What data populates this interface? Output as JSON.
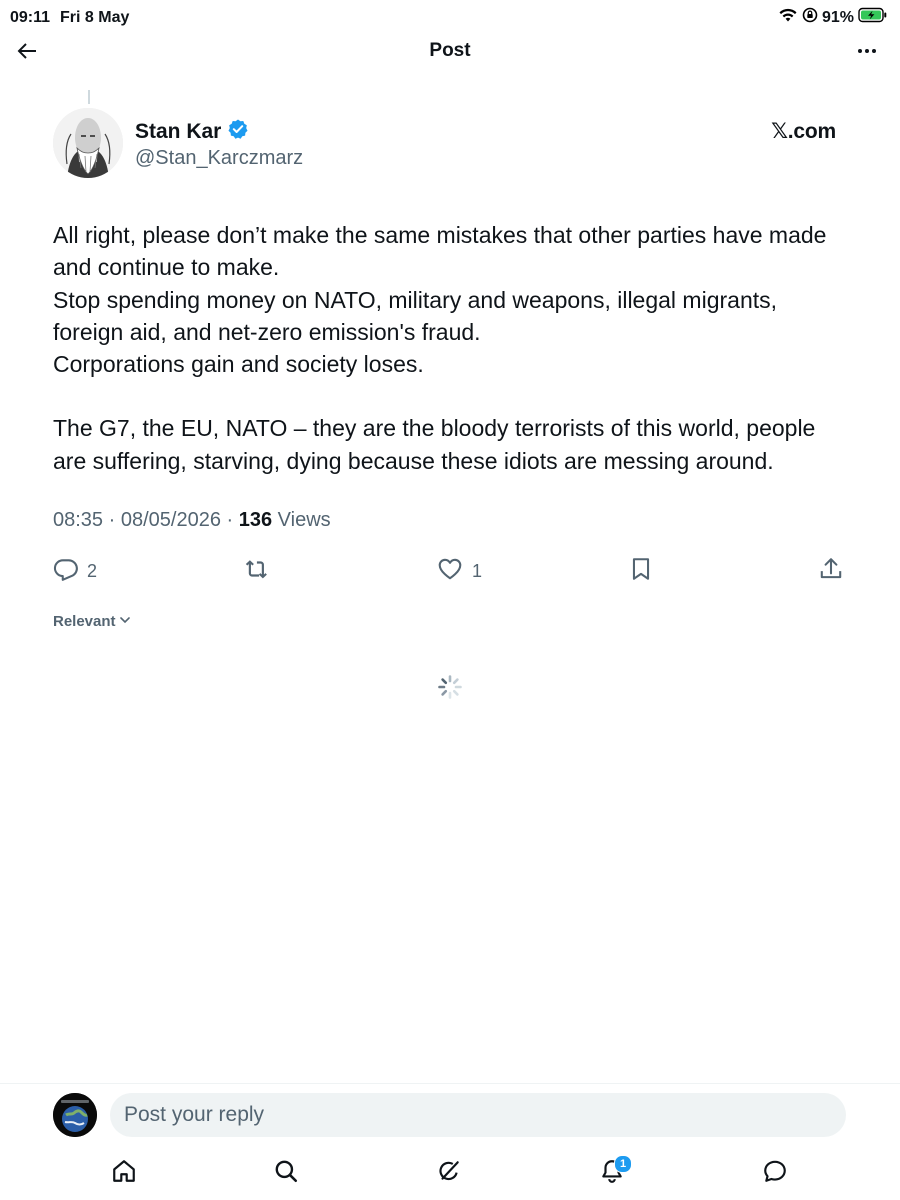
{
  "status_bar": {
    "time": "09:11",
    "date": "Fri 8 May",
    "battery": "91%",
    "battery_color": "#34c759"
  },
  "header": {
    "title": "Post",
    "back_icon": "arrow-left-icon",
    "more_icon": "more-horizontal-icon"
  },
  "author": {
    "name": "Stan Kar",
    "handle": "@Stan_Karczmarz",
    "verified_color": "#1d9bf0",
    "watermark": "𝕏.com"
  },
  "post": {
    "paragraphs": [
      "All right, please don’t make the same mistakes that other parties have made and continue to make.",
      "Stop spending money on NATO, military and weapons, illegal migrants, foreign aid, and net-zero emission's fraud.",
      "Corporations gain and society loses.",
      "The G7, the EU, NATO – they are the bloody terrorists of this world, people are suffering, starving, dying because these idiots are messing around."
    ],
    "time": "08:35",
    "date": "08/05/2026",
    "views_count": "136",
    "views_label": "Views"
  },
  "actions": {
    "reply_count": "2",
    "repost_count": "",
    "like_count": "1"
  },
  "replies": {
    "sort_label": "Relevant"
  },
  "reply_bar": {
    "placeholder": "Post your reply"
  },
  "tabbar": {
    "notifications_badge": "1",
    "accent": "#1d9bf0"
  }
}
